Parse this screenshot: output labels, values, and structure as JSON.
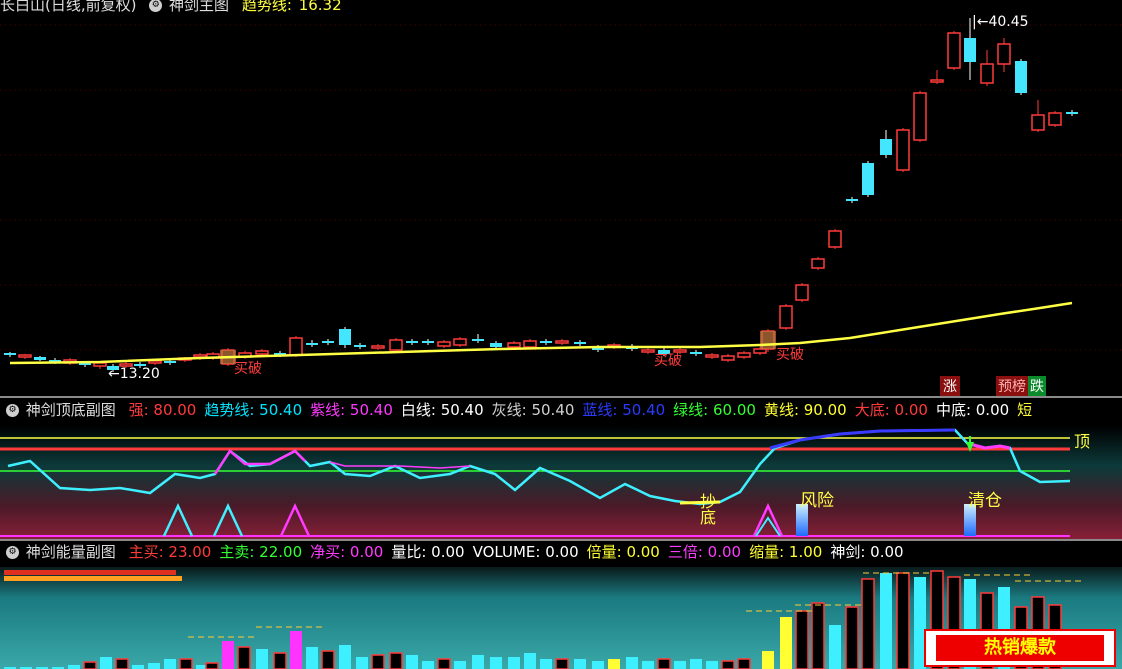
{
  "main": {
    "title": "长白山(日线,前复权)",
    "indicator": "神剑主图",
    "trend_label": "趋势线:",
    "trend_value": "16.32",
    "high_marker": "40.45",
    "low_marker": "13.20",
    "buy_signal": "买破",
    "rise_tag": "涨",
    "pre_tag": "预榜",
    "fall_tag": "跌"
  },
  "panel1": {
    "title": "神剑顶底副图",
    "fields": [
      {
        "k": "强:",
        "v": "80.00",
        "color": "#ff3b3b"
      },
      {
        "k": "趋势线:",
        "v": "50.40",
        "color": "#00e5ff"
      },
      {
        "k": "紫线:",
        "v": "50.40",
        "color": "#ff3bff"
      },
      {
        "k": "白线:",
        "v": "50.40",
        "color": "#ffffff"
      },
      {
        "k": "灰线:",
        "v": "50.40",
        "color": "#d0d0d0"
      },
      {
        "k": "蓝线:",
        "v": "50.40",
        "color": "#2a3bff"
      },
      {
        "k": "绿线:",
        "v": "60.00",
        "color": "#33ff33"
      },
      {
        "k": "黄线:",
        "v": "90.00",
        "color": "#ffff33"
      },
      {
        "k": "大底:",
        "v": "0.00",
        "color": "#ff3b3b"
      },
      {
        "k": "中底:",
        "v": "0.00",
        "color": "#ffffff"
      },
      {
        "k": "短",
        "v": "",
        "color": "#ffff33"
      }
    ],
    "labels": {
      "top": "顶",
      "bottom_cn": "底",
      "risk": "风险",
      "clear": "清仓",
      "copy": "抄"
    }
  },
  "panel2": {
    "title": "神剑能量副图",
    "fields": [
      {
        "k": "主买:",
        "v": "23.00",
        "color": "#ff3b3b"
      },
      {
        "k": "主卖:",
        "v": "22.00",
        "color": "#33ff33"
      },
      {
        "k": "净买:",
        "v": "0.00",
        "color": "#ff3bff"
      },
      {
        "k": "量比:",
        "v": "0.00",
        "color": "#ffffff"
      },
      {
        "k": "VOLUME:",
        "v": "0.00",
        "color": "#ffffff"
      },
      {
        "k": "倍量:",
        "v": "0.00",
        "color": "#ffff33"
      },
      {
        "k": "三倍:",
        "v": "0.00",
        "color": "#ff3bff"
      },
      {
        "k": "缩量:",
        "v": "1.00",
        "color": "#ffff33"
      },
      {
        "k": "神剑:",
        "v": "0.00",
        "color": "#ffffff"
      }
    ]
  },
  "badge": "热销爆款",
  "colors": {
    "up": "#ff3b3b",
    "down": "#44e6ff",
    "trend": "#ffff44"
  }
}
